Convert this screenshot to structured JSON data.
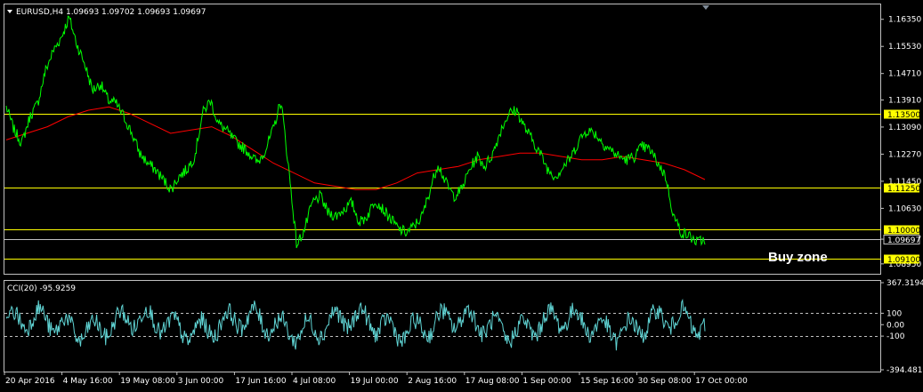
{
  "header": {
    "menu_icon": "triangle-down-icon",
    "text": "EURUSD,H4  1.09693 1.09702 1.09693 1.09697"
  },
  "annotation": "Buy zone",
  "colors": {
    "background": "#000000",
    "price": "#00ff00",
    "moving_average": "#ff0000",
    "levels": "#ffff00",
    "level_label_bg": "#ffff00",
    "cci": "#5fd3d3",
    "frame": "#c0c0c0"
  },
  "chart_data": [
    {
      "type": "line",
      "title": "EURUSD,H4",
      "ylim": [
        1.0865,
        1.168
      ],
      "y_ticks": [
        "1.16350",
        "1.15530",
        "1.14710",
        "1.13910",
        "1.13090",
        "1.12270",
        "1.11450",
        "1.10630",
        "1.09697",
        "1.08950"
      ],
      "x_ticks": [
        "20 Apr 2016",
        "4 May 16:00",
        "19 May 08:00",
        "3 Jun 00:00",
        "17 Jun 16:00",
        "4 Jul 08:00",
        "19 Jul 00:00",
        "2 Aug 16:00",
        "17 Aug 08:00",
        "1 Sep 00:00",
        "15 Sep 16:00",
        "30 Sep 08:00",
        "17 Oct 00:00"
      ],
      "series": [
        {
          "values": [
            1.137,
            1.13,
            1.126,
            1.134,
            1.138,
            1.148,
            1.154,
            1.158,
            1.164,
            1.156,
            1.15,
            1.142,
            1.144,
            1.139,
            1.138,
            1.134,
            1.129,
            1.123,
            1.12,
            1.118,
            1.115,
            1.112,
            1.116,
            1.118,
            1.122,
            1.135,
            1.139,
            1.132,
            1.13,
            1.127,
            1.125,
            1.123,
            1.12,
            1.124,
            1.13,
            1.139,
            1.118,
            1.095,
            1.1,
            1.108,
            1.11,
            1.105,
            1.104,
            1.106,
            1.108,
            1.102,
            1.104,
            1.109,
            1.106,
            1.103,
            1.1,
            1.099,
            1.101,
            1.104,
            1.112,
            1.12,
            1.114,
            1.11,
            1.112,
            1.118,
            1.122,
            1.119,
            1.123,
            1.13,
            1.135,
            1.136,
            1.131,
            1.127,
            1.123,
            1.118,
            1.116,
            1.119,
            1.122,
            1.127,
            1.13,
            1.129,
            1.126,
            1.124,
            1.122,
            1.121,
            1.122,
            1.125,
            1.124,
            1.12,
            1.116,
            1.104,
            1.099,
            1.098,
            1.096,
            1.097
          ],
          "moving_average": [
            1.127,
            1.129,
            1.131,
            1.134,
            1.136,
            1.137,
            1.135,
            1.132,
            1.129,
            1.13,
            1.131,
            1.128,
            1.124,
            1.12,
            1.117,
            1.114,
            1.113,
            1.112,
            1.112,
            1.114,
            1.117,
            1.118,
            1.119,
            1.121,
            1.122,
            1.123,
            1.123,
            1.122,
            1.121,
            1.121,
            1.122,
            1.121,
            1.12,
            1.118,
            1.115
          ]
        }
      ],
      "horizontal_levels": [
        {
          "label": "1.13500",
          "value": 1.135,
          "highlighted": true
        },
        {
          "label": "1.11250",
          "value": 1.1125,
          "highlighted": true
        },
        {
          "label": "1.10000",
          "value": 1.1,
          "highlighted": true
        },
        {
          "label": "1.09697",
          "value": 1.097,
          "highlighted": false
        },
        {
          "label": "1.09100",
          "value": 1.091,
          "highlighted": true
        }
      ]
    },
    {
      "type": "line",
      "title": "CCI(20) -95.9259",
      "ylim": [
        -394.4815,
        367.3194
      ],
      "y_ticks": [
        "367.3194",
        "100",
        "0.00",
        "-100",
        "-394.4815"
      ],
      "dashed_levels": [
        100,
        -100
      ]
    }
  ]
}
